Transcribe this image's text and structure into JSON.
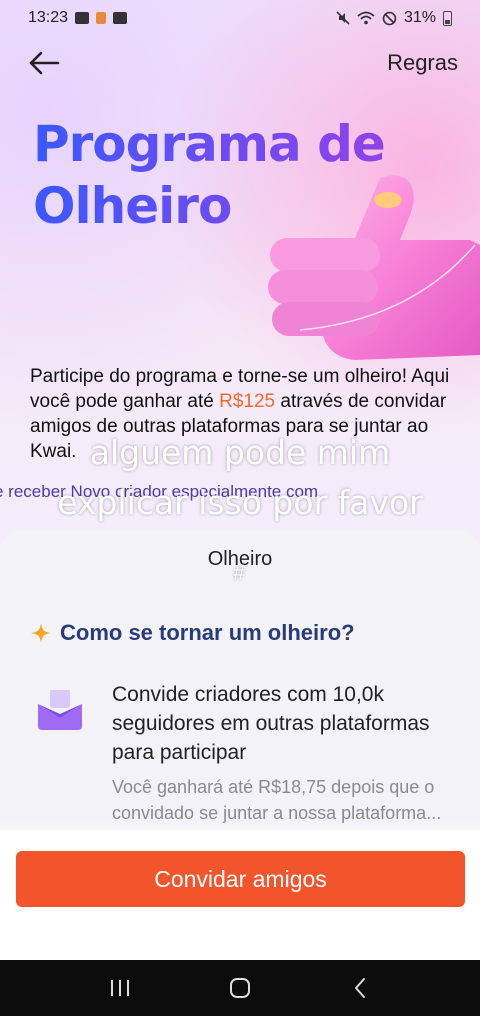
{
  "status_bar": {
    "time": "13:23",
    "battery_percent": "31%",
    "icons": [
      "gallery-icon",
      "app-notification-icon",
      "camera-icon",
      "mute-icon",
      "wifi-icon",
      "do-not-disturb-icon",
      "battery-icon"
    ]
  },
  "header": {
    "back_icon": "arrow-left-icon",
    "rules_label": "Regras"
  },
  "hero": {
    "title_line1": "Programa de",
    "title_line2": "Olheiro",
    "illustration": "thumbs-up-hand",
    "description_before": "Participe do programa e torne-se um olheiro! Aqui você pode ganhar até ",
    "description_amount": "R$125",
    "description_after": " através de convidar amigos de outras plataformas para se juntar ao Kwai.",
    "ticker": "e receber Novo criador especialmente com"
  },
  "overlay": {
    "caption_line1": "alguem pode mim",
    "caption_line2": "explicar isso por favor",
    "hashtag": "#"
  },
  "sheet": {
    "title": "Olheiro",
    "section_heading": "Como se tornar um olheiro?",
    "step": {
      "icon": "envelope-icon",
      "title": "Convide criadores com 10,0k seguidores em outras plataformas para participar",
      "detail": "Você ganhará até R$18,75 depois que o convidado se juntar a nossa plataforma..."
    }
  },
  "action": {
    "invite_label": "Convidar amigos"
  },
  "colors": {
    "accent": "#f2552c",
    "amount": "#f26a2e",
    "heading": "#2a3b7a",
    "title_gradient_start": "#3a58ff",
    "title_gradient_end": "#9a3fe4"
  },
  "system_nav": {
    "buttons": [
      "recent-apps-icon",
      "home-icon",
      "back-icon"
    ]
  }
}
